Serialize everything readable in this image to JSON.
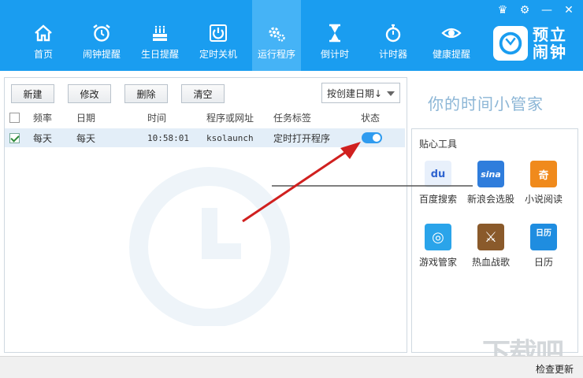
{
  "nav": {
    "items": [
      {
        "label": "首页",
        "icon": "home-icon"
      },
      {
        "label": "闹钟提醒",
        "icon": "alarm-clock-icon"
      },
      {
        "label": "生日提醒",
        "icon": "birthday-cake-icon"
      },
      {
        "label": "定时关机",
        "icon": "power-icon"
      },
      {
        "label": "运行程序",
        "icon": "gears-icon"
      },
      {
        "label": "倒计时",
        "icon": "hourglass-icon"
      },
      {
        "label": "计时器",
        "icon": "stopwatch-icon"
      },
      {
        "label": "健康提醒",
        "icon": "eye-icon"
      }
    ],
    "active_index": 4
  },
  "logo": {
    "text": "预立闹钟",
    "badge": "预立闹钟"
  },
  "toolbar": {
    "new_label": "新建",
    "edit_label": "修改",
    "delete_label": "删除",
    "clear_label": "清空",
    "sort_label": "按创建日期↓"
  },
  "table": {
    "headers": {
      "freq": "频率",
      "date": "日期",
      "time": "时间",
      "target": "程序或网址",
      "tag": "任务标签",
      "status": "状态"
    },
    "rows": [
      {
        "freq": "每天",
        "date": "每天",
        "time": "10:58:01",
        "target": "ksolaunch",
        "tag": "定时打开程序",
        "enabled": true,
        "checked": true
      }
    ]
  },
  "right": {
    "slogan": "你的时间小管家",
    "tools_title": "贴心工具",
    "tools": [
      {
        "label": "百度搜索",
        "icon": "baidu-icon",
        "glyph": "du",
        "color": "#e8f0fb"
      },
      {
        "label": "新浪会选股",
        "icon": "sina-icon",
        "glyph": "sina",
        "color": "#2f7ddc"
      },
      {
        "label": "小说阅读",
        "icon": "novel-icon",
        "glyph": "奇",
        "color": "#f08a1c"
      },
      {
        "label": "游戏管家",
        "icon": "game-bag-icon",
        "glyph": "◎",
        "color": "#2aa4ea"
      },
      {
        "label": "热血战歌",
        "icon": "war-game-icon",
        "glyph": "⚔",
        "color": "#8a5a2b"
      },
      {
        "label": "日历",
        "icon": "calendar-icon",
        "glyph": "日历",
        "color": "#1f8de0"
      }
    ]
  },
  "footer": {
    "update_label": "检查更新",
    "site_mark": "下载吧"
  }
}
